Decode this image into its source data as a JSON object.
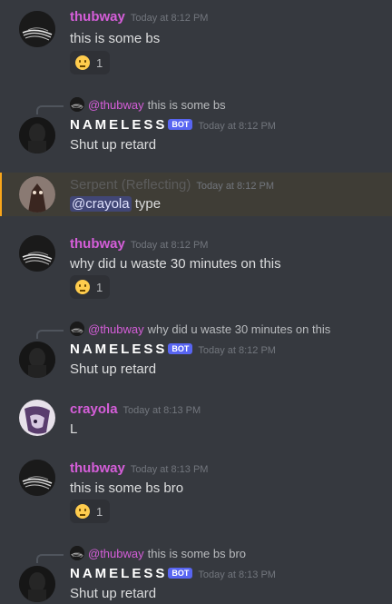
{
  "messages": [
    {
      "user": "thubway",
      "time": "Today at 8:12 PM",
      "text": "this is some bs",
      "reaction": {
        "emoji": "neutral-face",
        "count": "1"
      }
    },
    {
      "reply_to_user": "@thubway",
      "reply_to_text": "this is some bs",
      "user": "NAMELESS",
      "bot": "BOT",
      "time": "Today at 8:12 PM",
      "text": "Shut up retard"
    },
    {
      "user": "Serpent (Reflecting)",
      "time": "Today at 8:12 PM",
      "mention": "@crayola",
      "text": "type"
    },
    {
      "user": "thubway",
      "time": "Today at 8:12 PM",
      "text": "why did u waste 30 minutes on this",
      "reaction": {
        "emoji": "neutral-face",
        "count": "1"
      }
    },
    {
      "reply_to_user": "@thubway",
      "reply_to_text": "why did u waste 30 minutes on this",
      "user": "NAMELESS",
      "bot": "BOT",
      "time": "Today at 8:12 PM",
      "text": "Shut up retard"
    },
    {
      "user": "crayola",
      "time": "Today at 8:13 PM",
      "text": "L"
    },
    {
      "user": "thubway",
      "time": "Today at 8:13 PM",
      "text": "this is some bs bro",
      "reaction": {
        "emoji": "neutral-face",
        "count": "1"
      }
    },
    {
      "reply_to_user": "@thubway",
      "reply_to_text": "this is some bs bro",
      "user": "NAMELESS",
      "bot": "BOT",
      "time": "Today at 8:13 PM",
      "text": "Shut up retard"
    }
  ],
  "colors": {
    "background": "#36393f",
    "username_pink": "#d55ed9",
    "bot_tag": "#5865f2",
    "highlight_border": "#faa61a"
  }
}
